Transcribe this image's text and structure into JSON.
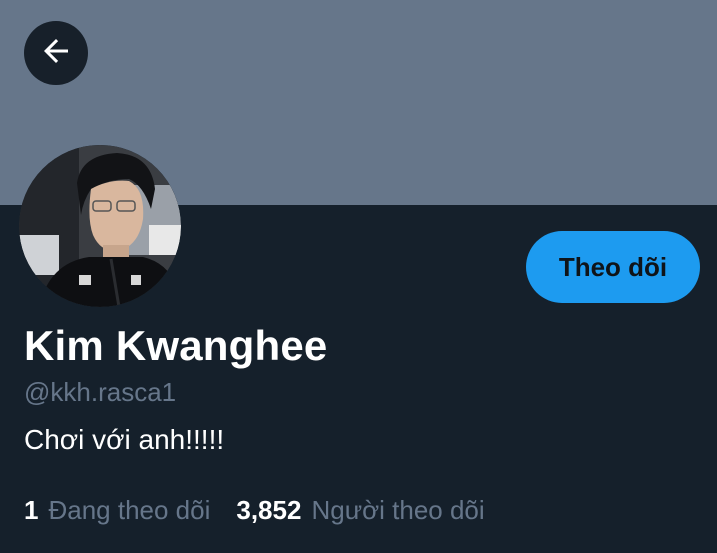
{
  "profile": {
    "display_name": "Kim Kwanghee",
    "handle": "@kkh.rasca1",
    "bio": "Chơi với anh!!!!!",
    "follow_label": "Theo dõi",
    "avatar_icon": "profile-photo"
  },
  "stats": {
    "following_count": "1",
    "following_label": "Đang theo dõi",
    "followers_count": "3,852",
    "followers_label": "Người theo dõi"
  },
  "colors": {
    "background": "#15202b",
    "banner": "#66768a",
    "accent": "#1d9bf0",
    "muted_text": "#66768a"
  },
  "icons": {
    "back": "arrow-left-icon"
  }
}
